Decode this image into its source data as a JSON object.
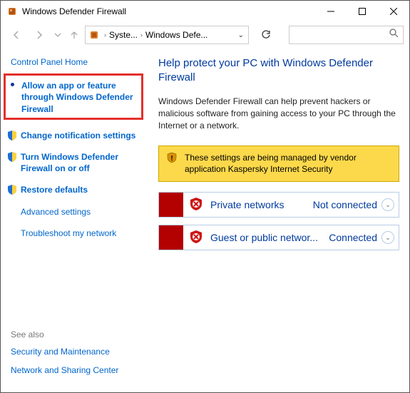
{
  "window": {
    "title": "Windows Defender Firewall"
  },
  "nav": {
    "breadcrumb": {
      "item1": "Syste...",
      "item2": "Windows Defe..."
    }
  },
  "sidebar": {
    "home": "Control Panel Home",
    "allow_app": "Allow an app or feature through Windows Defender Firewall",
    "change_notif": "Change notification settings",
    "turn_onoff": "Turn Windows Defender Firewall on or off",
    "restore": "Restore defaults",
    "advanced": "Advanced settings",
    "troubleshoot": "Troubleshoot my network",
    "see_also": "See also",
    "sec_maint": "Security and Maintenance",
    "net_share": "Network and Sharing Center"
  },
  "main": {
    "heading": "Help protect your PC with Windows Defender Firewall",
    "desc": "Windows Defender Firewall can help prevent hackers or malicious software from gaining access to your PC through the Internet or a network.",
    "banner": "These settings are being managed by vendor application Kaspersky Internet Security",
    "net_private": {
      "label": "Private networks",
      "status": "Not connected"
    },
    "net_public": {
      "label": "Guest or public networ...",
      "status": "Connected"
    }
  }
}
